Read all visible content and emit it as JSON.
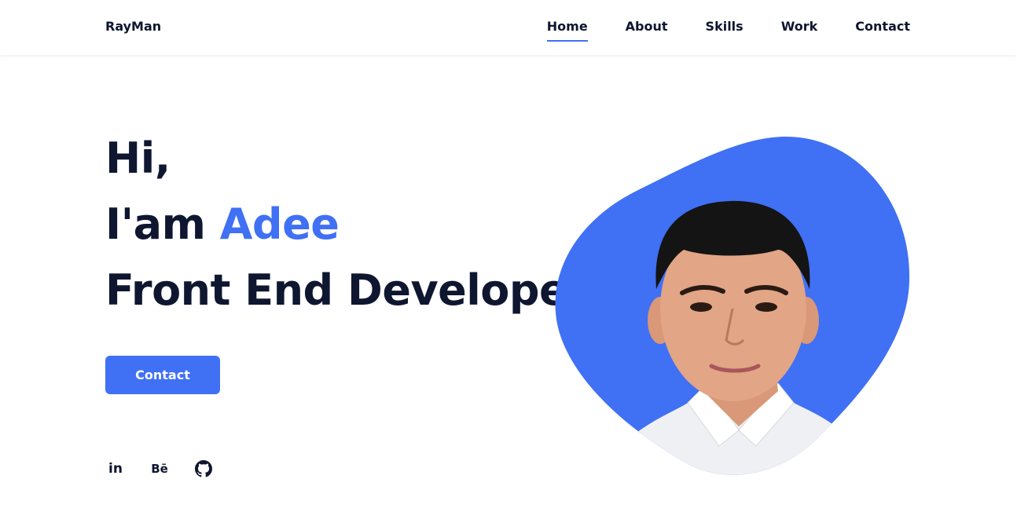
{
  "header": {
    "logo": "RayMan",
    "nav": [
      {
        "label": "Home",
        "active": true
      },
      {
        "label": "About",
        "active": false
      },
      {
        "label": "Skills",
        "active": false
      },
      {
        "label": "Work",
        "active": false
      },
      {
        "label": "Contact",
        "active": false
      }
    ]
  },
  "hero": {
    "line1": "Hi,",
    "line2_prefix": "I'am ",
    "name": "Adee",
    "line3": "Front End Developer",
    "button_label": "Contact"
  },
  "socials": [
    {
      "icon": "linkedin-icon",
      "glyph": "in"
    },
    {
      "icon": "behance-icon",
      "glyph": "Bē"
    },
    {
      "icon": "github-icon"
    }
  ],
  "colors": {
    "accent": "#4070f4",
    "text": "#0e1630",
    "background": "#ffffff"
  }
}
